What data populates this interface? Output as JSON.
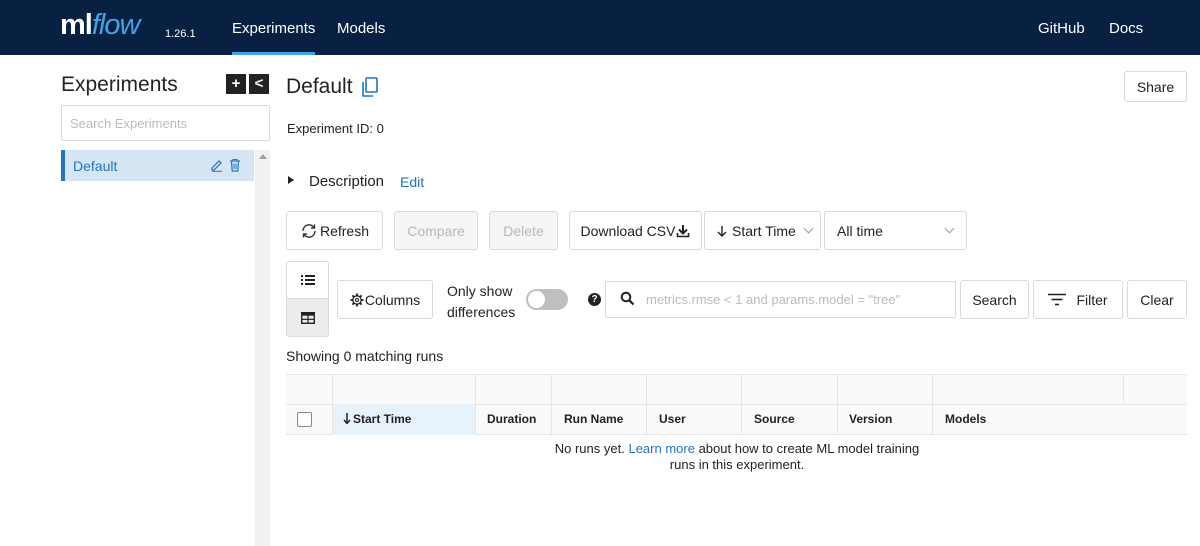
{
  "header": {
    "logo_ml": "ml",
    "logo_flow": "flow",
    "version": "1.26.1",
    "nav": [
      {
        "label": "Experiments",
        "active": true
      },
      {
        "label": "Models",
        "active": false
      }
    ],
    "right_nav": [
      {
        "label": "GitHub"
      },
      {
        "label": "Docs"
      }
    ],
    "colors": {
      "background": "#082142",
      "accent": "#43a3e6"
    }
  },
  "sidebar": {
    "title": "Experiments",
    "add_icon": "plus-icon",
    "collapse_icon": "chevron-left-icon",
    "search_placeholder": "Search Experiments",
    "experiments": [
      {
        "label": "Default",
        "selected": true,
        "edit_icon": "pencil-icon",
        "delete_icon": "trash-icon"
      }
    ]
  },
  "main": {
    "title": "Default",
    "copy_icon": "copy-icon",
    "share_label": "Share",
    "experiment_id_label": "Experiment ID:",
    "experiment_id_value": "0",
    "description_label": "Description",
    "description_edit": "Edit",
    "toolbar": {
      "refresh": "Refresh",
      "compare": "Compare",
      "delete": "Delete",
      "download": "Download CSV",
      "sort": "Start Time",
      "time_range": "All time"
    },
    "view_toggle": {
      "list_icon": "list-icon",
      "table_icon": "table-icon",
      "selected": "table"
    },
    "columns_label": "Columns",
    "diff_toggle_line1": "Only show",
    "diff_toggle_line2": "differences",
    "diff_toggle_on": false,
    "search_placeholder": "metrics.rmse < 1 and params.model = \"tree\"",
    "search_button": "Search",
    "filter_button": "Filter",
    "clear_button": "Clear",
    "showing_text": "Showing 0 matching runs",
    "table": {
      "sorted_column": "Start Time",
      "columns": [
        "Start Time",
        "Duration",
        "Run Name",
        "User",
        "Source",
        "Version",
        "Models"
      ]
    },
    "empty": {
      "before": "No runs yet.",
      "link": "Learn more",
      "after_line1": "about how to create ML model training",
      "line2": "runs in this experiment."
    }
  }
}
